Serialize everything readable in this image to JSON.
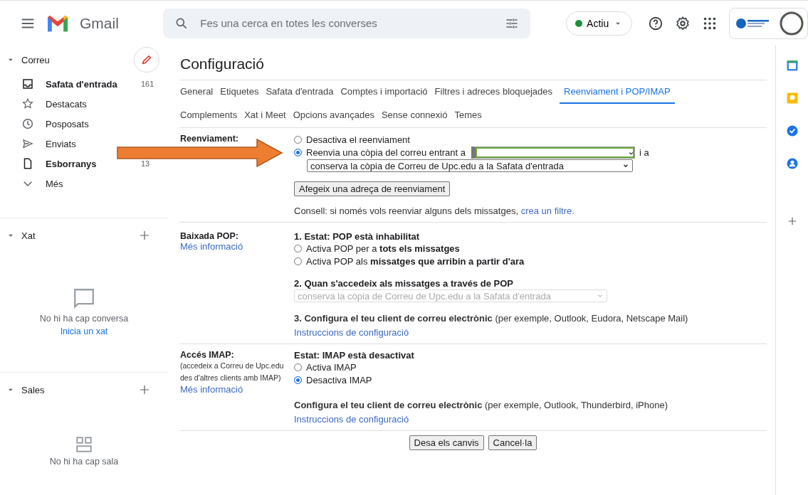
{
  "header": {
    "app_name": "Gmail",
    "search": {
      "placeholder": "Fes una cerca en totes les converses"
    },
    "status": "Actiu"
  },
  "sidebar": {
    "mail": {
      "title": "Correu",
      "items": [
        {
          "label": "Safata d'entrada",
          "count": "161",
          "bold": true
        },
        {
          "label": "Destacats",
          "bold": false
        },
        {
          "label": "Posposats",
          "bold": false
        },
        {
          "label": "Enviats",
          "bold": false
        },
        {
          "label": "Esborranys",
          "count": "13",
          "bold": true
        },
        {
          "label": "Més",
          "bold": false
        }
      ]
    },
    "chat": {
      "title": "Xat",
      "empty_text": "No hi ha cap conversa",
      "link": "Inicia un xat"
    },
    "rooms": {
      "title": "Sales",
      "empty_text": "No hi ha cap sala"
    }
  },
  "settings": {
    "title": "Configuració",
    "tab_rows": [
      [
        {
          "label": "General",
          "selected": false
        },
        {
          "label": "Etiquetes",
          "selected": false
        },
        {
          "label": "Safata d'entrada",
          "selected": false
        },
        {
          "label": "Comptes i importació",
          "selected": false
        },
        {
          "label": "Filtres i adreces bloquejades",
          "selected": false
        },
        {
          "label": "Reenviament i POP/IMAP",
          "selected": true
        }
      ],
      [
        {
          "label": "Complements",
          "selected": false
        },
        {
          "label": "Xat i Meet",
          "selected": false
        },
        {
          "label": "Opcions avançades",
          "selected": false
        },
        {
          "label": "Sense connexió",
          "selected": false
        },
        {
          "label": "Temes",
          "selected": false
        }
      ]
    ],
    "forwarding": {
      "label": "Reenviament:",
      "options": [
        {
          "label": "Desactiva el reenviament",
          "selected": false
        },
        {
          "label": "Reenvia una còpia del correu entrant a",
          "selected": true
        }
      ],
      "after_field": "i a",
      "mode": "conserva la còpia de Correu de Upc.edu a la Safata d'entrada",
      "add_button": "Afegeix una adreça de reenviament",
      "tip": "Consell: si només vols reenviar alguns dels missatges,",
      "tip_link": "crea un filtre."
    },
    "pop": {
      "label": "Baixada POP:",
      "link": "Més informació",
      "status": "1. Estat: POP està inhabilitat",
      "options": [
        {
          "label": "Activa POP per a **tots els missatges**",
          "selected": false
        },
        {
          "label": "Activa POP als **missatges que arribin a partir d'ara**",
          "selected": false
        }
      ],
      "step2": "2. Quan s'accedeix als missatges a través de POP",
      "step2_value": "conserva la còpia de Correu de Upc.edu a la Safata d'entrada",
      "step3": "**3. Configura el teu client de correu electrònic** (per exemple, Outlook, Eudora, Netscape Mail)",
      "step3_link": "Instruccions de configuració"
    },
    "imap": {
      "label": "Accés IMAP:",
      "note": "(accedeix a Correu de Upc.edu des d'altres clients amb IMAP)",
      "link": "Més informació",
      "status": "Estat: IMAP està desactivat",
      "options": [
        {
          "label": "Activa IMAP",
          "selected": false
        },
        {
          "label": "Desactiva IMAP",
          "selected": true
        }
      ],
      "config": "**Configura el teu client de correu electrònic** (per exemple, Outlook, Thunderbird, iPhone)",
      "config_link": "Instruccions de configuració"
    },
    "buttons": [
      "Desa els canvis",
      "Cancel·la"
    ]
  }
}
